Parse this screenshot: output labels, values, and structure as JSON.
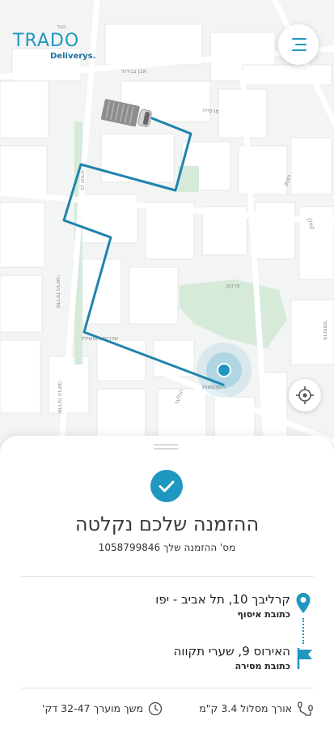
{
  "brand": {
    "logo": "TRADO",
    "sub": "Deliverys."
  },
  "colors": {
    "accent": "#1f97c0",
    "park": "#d6ead9",
    "route": "#1f83ad"
  },
  "map": {
    "street_labels": [
      "שדרות הרשבי",
      "שדרות הרשבי",
      "בן יהודה",
      "מרסייה",
      "אבן גבירול",
      "ויצמן",
      "קפלן",
      "הגר",
      "פרוטן",
      "הגלעד",
      "שדרות רוטשילד",
      "העצמאות",
      "פרופסור"
    ]
  },
  "icons": {
    "menu": "menu-icon",
    "locate": "crosshair-icon",
    "check": "checkmark-icon",
    "pin": "location-pin-icon",
    "flag": "flag-icon",
    "clock": "clock-icon",
    "route": "route-icon"
  },
  "status": {
    "title": "ההזמנה שלכם נקלטה",
    "order_label": "מס' ההזמנה שלך",
    "order_number": "1058799846"
  },
  "pickup": {
    "address": "קרליבך 10, תל אביב - יפו",
    "label": "כתובת איסוף"
  },
  "dropoff": {
    "address": "האירוס 9, שערי תקווה",
    "label": "כתובת מסירה"
  },
  "footer": {
    "route_label": "אורך מסלול",
    "route_value": "3.4 ק\"מ",
    "duration_label": "משך מוערך",
    "duration_value": "32-47 דק'"
  }
}
